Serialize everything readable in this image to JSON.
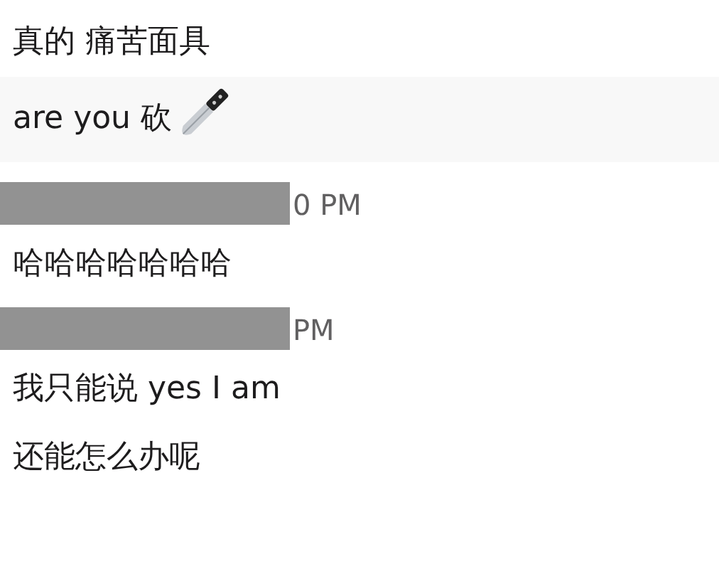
{
  "messages": [
    {
      "kind": "text",
      "text": "真的 痛苦面具",
      "highlighted": false
    },
    {
      "kind": "text_icon",
      "text": "are you 砍",
      "highlighted": true
    },
    {
      "kind": "header",
      "time": "0 PM"
    },
    {
      "kind": "text",
      "text": "哈哈哈哈哈哈哈",
      "highlighted": false
    },
    {
      "kind": "header",
      "time": "PM"
    },
    {
      "kind": "text",
      "text": "我只能说 yes I am",
      "highlighted": false
    },
    {
      "kind": "text",
      "text": "还能怎么办呢",
      "highlighted": false
    }
  ]
}
